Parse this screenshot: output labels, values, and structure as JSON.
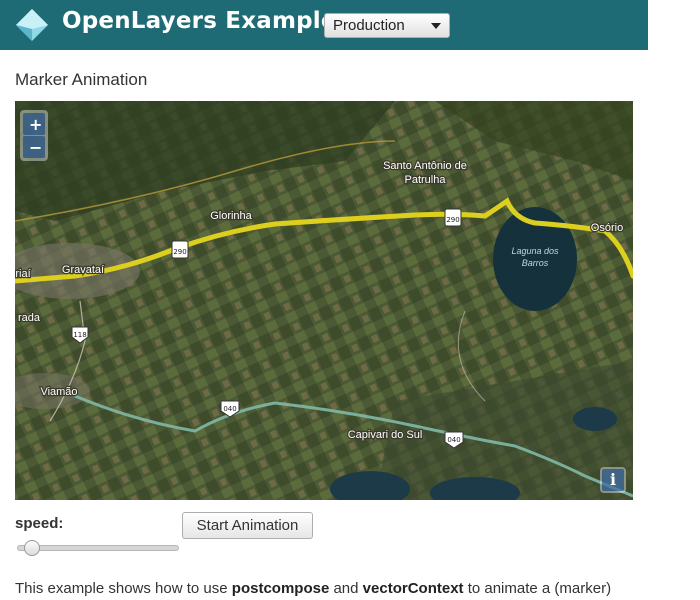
{
  "header": {
    "brand": "OpenLayers Examples",
    "version_selected": "Production"
  },
  "page": {
    "title": "Marker Animation"
  },
  "map": {
    "zoom_in_label": "+",
    "zoom_out_label": "−",
    "attribution_label": "i",
    "places": [
      "Santo Antônio de",
      "Patrulha",
      "Glorinha",
      "Osório",
      "Gravataí",
      "Laguna dos",
      "Barros",
      "rada",
      "Viamão",
      "Capivari do Sul",
      "riaí"
    ],
    "road_shields": [
      "290",
      "290",
      "118",
      "040",
      "040"
    ]
  },
  "controls": {
    "speed_label": "speed:",
    "speed_value": 0.05,
    "start_button_label": "Start Animation"
  },
  "description": {
    "prefix": "This example shows how to use ",
    "term1": "postcompose",
    "middle": " and ",
    "term2": "vectorContext",
    "suffix": " to animate a (marker)"
  },
  "colors": {
    "navbar": "#1f6b75",
    "route": "#dccf1e",
    "road_secondary": "#7fb9a6"
  }
}
